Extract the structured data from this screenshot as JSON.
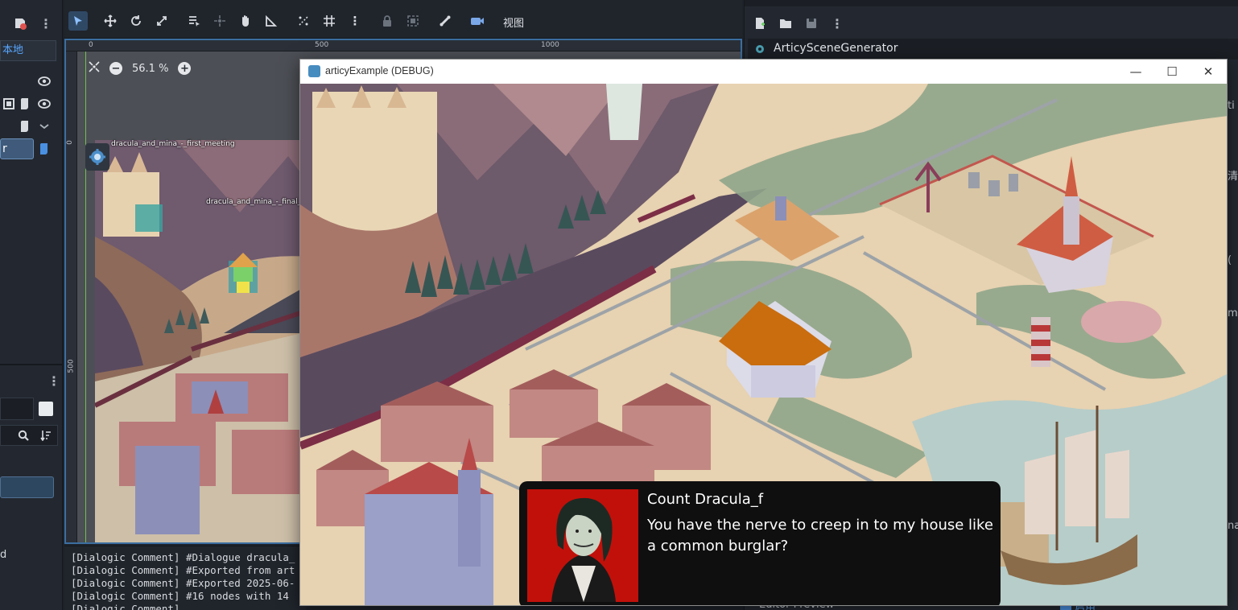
{
  "left_dock": {
    "local_tab": "本地",
    "selected_node": "r",
    "bottom_label": "d"
  },
  "toolbar": {
    "view_menu": "视图"
  },
  "viewport": {
    "zoom_level": "56.1 %",
    "ruler_top": [
      "0",
      "500",
      "1000"
    ],
    "ruler_left": [
      "0",
      "500"
    ],
    "node_labels": {
      "first_meeting": "dracula_and_mina_-_first_meeting",
      "final": "dracula_and_mina_-_final_c"
    }
  },
  "output": {
    "lines": [
      "[Dialogic Comment] #Dialogue dracula_",
      "[Dialogic Comment] #Exported from art",
      "[Dialogic Comment] #Exported 2025-06-",
      "[Dialogic Comment] #16 nodes with 14",
      "[Dialogic Comment]"
    ]
  },
  "inspector": {
    "title": "ArticySceneGenerator",
    "side_fragments": [
      "ti",
      "清",
      "(",
      "m",
      "na"
    ],
    "editor_preview": "Editor Preview",
    "enable_label": "启用"
  },
  "game_window": {
    "title": "articyExample (DEBUG)",
    "minimize": "—",
    "maximize": "☐",
    "close": "✕"
  },
  "dialog": {
    "speaker": "Count Dracula_f",
    "text": "You have the nerve to creep in to my house like a common burglar?"
  },
  "colors": {
    "accent": "#58a6ff",
    "dialog_bg": "#0f0f10",
    "portrait_bg": "#c1100a",
    "editor_bg": "#1d2229"
  }
}
